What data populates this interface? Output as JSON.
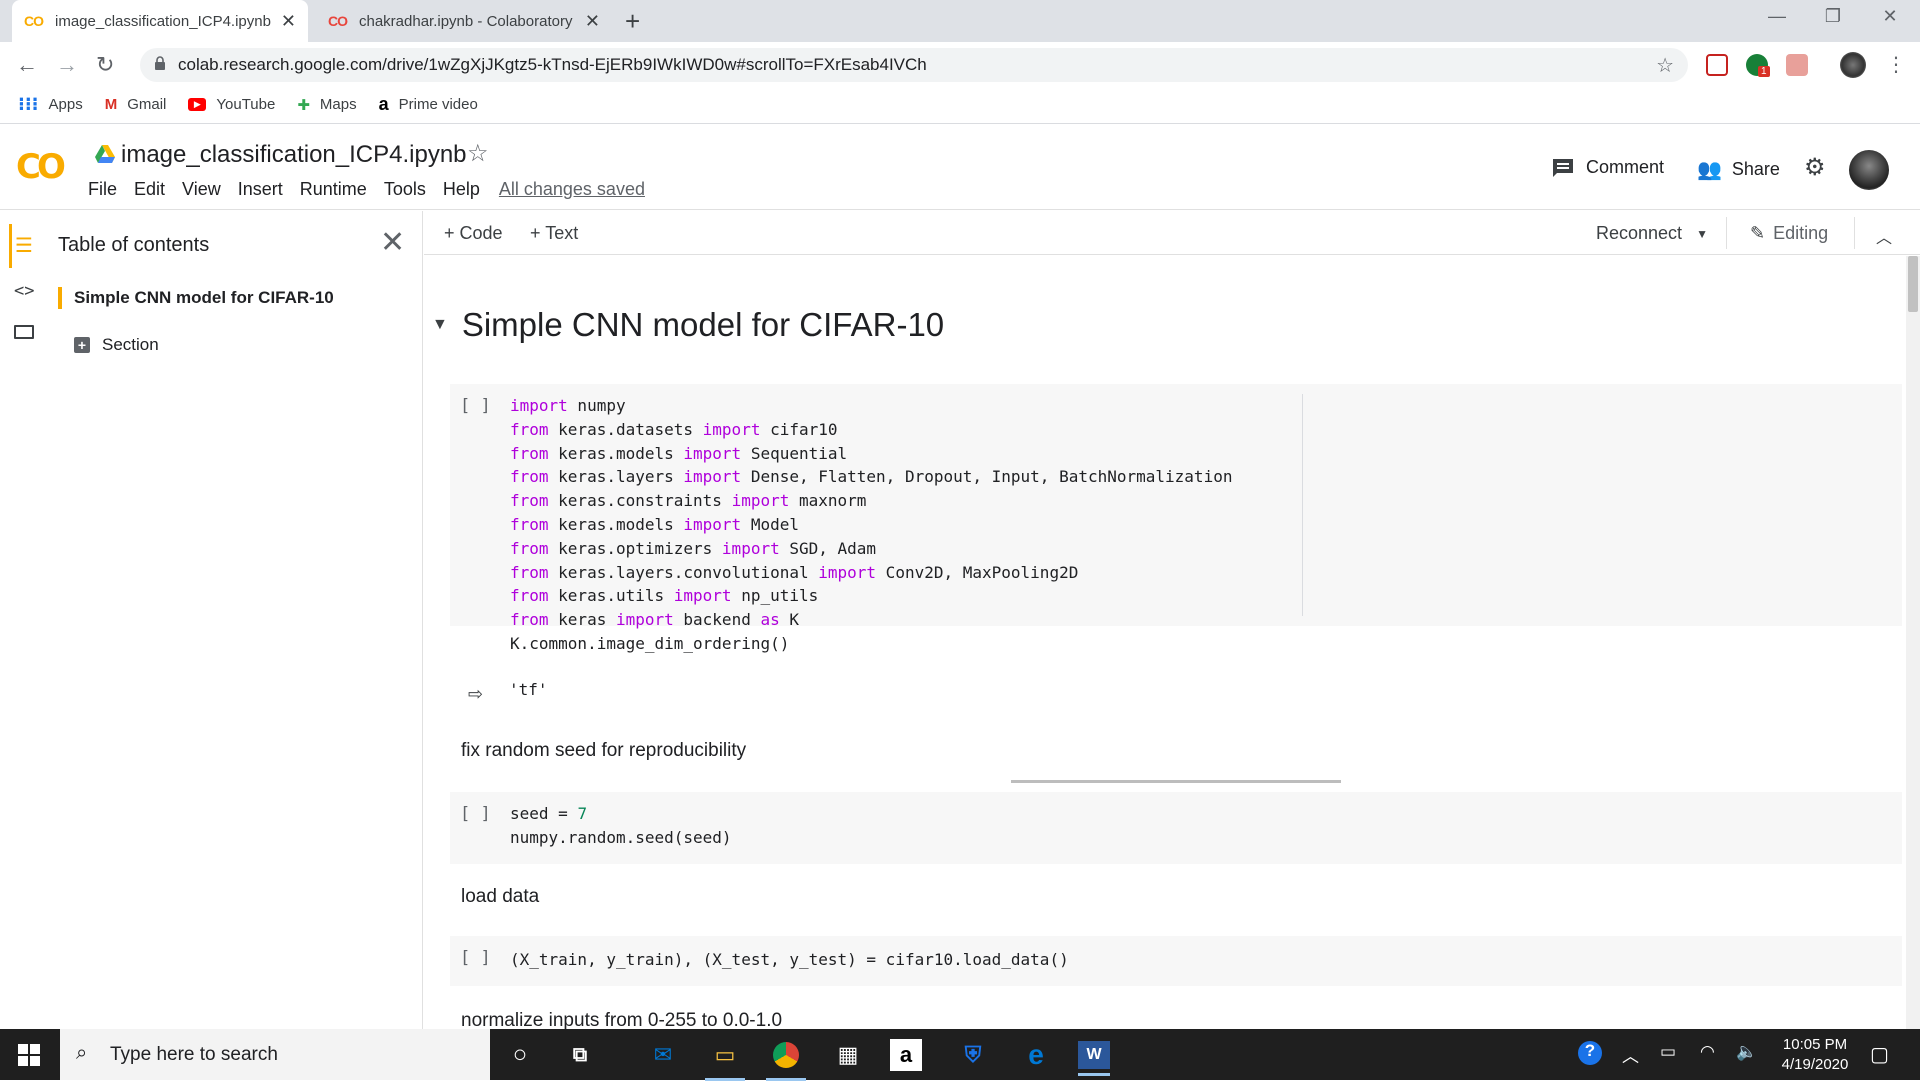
{
  "browser": {
    "tabs": [
      {
        "title": "image_classification_ICP4.ipynb - Colaboratory",
        "icon": "colab-icon",
        "active": true
      },
      {
        "title": "chakradhar.ipynb - Colaboratory",
        "icon": "colab-icon",
        "active": false
      }
    ],
    "new_tab_glyph": "+",
    "url": "colab.research.google.com/drive/1wZgXjJKgtz5-kTnsd-EjERb9IWkIWD0w#scrollTo=FXrEsab4IVCh",
    "extension_badge": "1",
    "bookmarks": [
      {
        "label": "Apps",
        "icon": "apps-grid-icon"
      },
      {
        "label": "Gmail",
        "icon": "gmail-icon"
      },
      {
        "label": "YouTube",
        "icon": "youtube-icon"
      },
      {
        "label": "Maps",
        "icon": "maps-icon"
      },
      {
        "label": "Prime video",
        "icon": "amazon-icon"
      }
    ]
  },
  "colab": {
    "logo": "CO",
    "notebook_title": "image_classification_ICP4.ipynb",
    "menu": [
      "File",
      "Edit",
      "View",
      "Insert",
      "Runtime",
      "Tools",
      "Help"
    ],
    "save_status": "All changes saved",
    "comment_label": "Comment",
    "share_label": "Share"
  },
  "sidebar": {
    "title": "Table of contents",
    "items": [
      {
        "label": "Simple CNN model for CIFAR-10"
      },
      {
        "label": "Section"
      }
    ]
  },
  "toolbar": {
    "add_code": "+ Code",
    "add_text": "+ Text",
    "reconnect": "Reconnect",
    "editing": "Editing"
  },
  "notebook": {
    "section_heading": "Simple CNN model for CIFAR-10",
    "run_button": "[ ]",
    "cell1_output": "'tf'",
    "text_seed": "fix random seed for reproducibility",
    "text_load": "load data",
    "text_normalize": "normalize inputs from 0-255 to 0.0-1.0"
  },
  "taskbar": {
    "search_placeholder": "Type here to search",
    "time": "10:05 PM",
    "date": "4/19/2020"
  },
  "colors": {
    "colab_orange": "#f9ab00",
    "keyword_purple": "#af00db",
    "number_green": "#098658",
    "taskbar_bg": "#1f1f1f"
  }
}
